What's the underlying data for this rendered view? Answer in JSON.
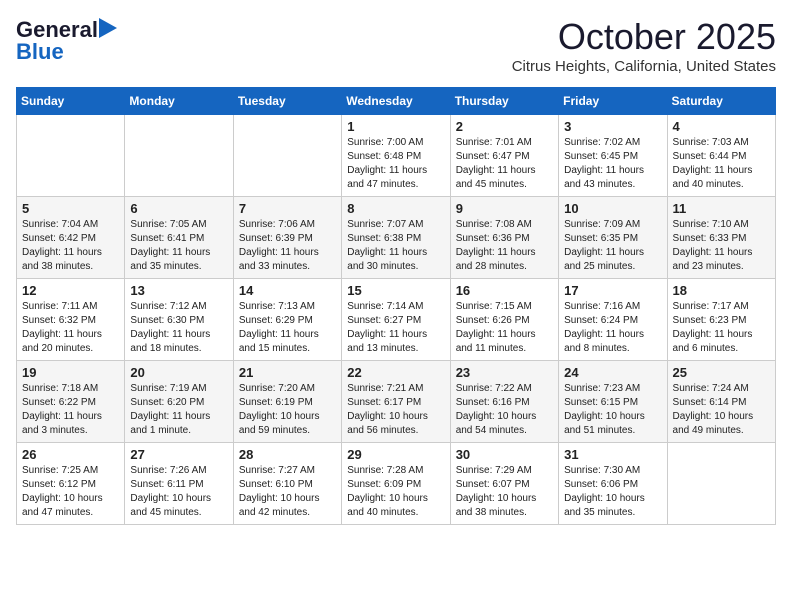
{
  "header": {
    "logo_general": "General",
    "logo_blue": "Blue",
    "month": "October 2025",
    "location": "Citrus Heights, California, United States"
  },
  "weekdays": [
    "Sunday",
    "Monday",
    "Tuesday",
    "Wednesday",
    "Thursday",
    "Friday",
    "Saturday"
  ],
  "weeks": [
    [
      {
        "day": "",
        "text": ""
      },
      {
        "day": "",
        "text": ""
      },
      {
        "day": "",
        "text": ""
      },
      {
        "day": "1",
        "text": "Sunrise: 7:00 AM\nSunset: 6:48 PM\nDaylight: 11 hours\nand 47 minutes."
      },
      {
        "day": "2",
        "text": "Sunrise: 7:01 AM\nSunset: 6:47 PM\nDaylight: 11 hours\nand 45 minutes."
      },
      {
        "day": "3",
        "text": "Sunrise: 7:02 AM\nSunset: 6:45 PM\nDaylight: 11 hours\nand 43 minutes."
      },
      {
        "day": "4",
        "text": "Sunrise: 7:03 AM\nSunset: 6:44 PM\nDaylight: 11 hours\nand 40 minutes."
      }
    ],
    [
      {
        "day": "5",
        "text": "Sunrise: 7:04 AM\nSunset: 6:42 PM\nDaylight: 11 hours\nand 38 minutes."
      },
      {
        "day": "6",
        "text": "Sunrise: 7:05 AM\nSunset: 6:41 PM\nDaylight: 11 hours\nand 35 minutes."
      },
      {
        "day": "7",
        "text": "Sunrise: 7:06 AM\nSunset: 6:39 PM\nDaylight: 11 hours\nand 33 minutes."
      },
      {
        "day": "8",
        "text": "Sunrise: 7:07 AM\nSunset: 6:38 PM\nDaylight: 11 hours\nand 30 minutes."
      },
      {
        "day": "9",
        "text": "Sunrise: 7:08 AM\nSunset: 6:36 PM\nDaylight: 11 hours\nand 28 minutes."
      },
      {
        "day": "10",
        "text": "Sunrise: 7:09 AM\nSunset: 6:35 PM\nDaylight: 11 hours\nand 25 minutes."
      },
      {
        "day": "11",
        "text": "Sunrise: 7:10 AM\nSunset: 6:33 PM\nDaylight: 11 hours\nand 23 minutes."
      }
    ],
    [
      {
        "day": "12",
        "text": "Sunrise: 7:11 AM\nSunset: 6:32 PM\nDaylight: 11 hours\nand 20 minutes."
      },
      {
        "day": "13",
        "text": "Sunrise: 7:12 AM\nSunset: 6:30 PM\nDaylight: 11 hours\nand 18 minutes."
      },
      {
        "day": "14",
        "text": "Sunrise: 7:13 AM\nSunset: 6:29 PM\nDaylight: 11 hours\nand 15 minutes."
      },
      {
        "day": "15",
        "text": "Sunrise: 7:14 AM\nSunset: 6:27 PM\nDaylight: 11 hours\nand 13 minutes."
      },
      {
        "day": "16",
        "text": "Sunrise: 7:15 AM\nSunset: 6:26 PM\nDaylight: 11 hours\nand 11 minutes."
      },
      {
        "day": "17",
        "text": "Sunrise: 7:16 AM\nSunset: 6:24 PM\nDaylight: 11 hours\nand 8 minutes."
      },
      {
        "day": "18",
        "text": "Sunrise: 7:17 AM\nSunset: 6:23 PM\nDaylight: 11 hours\nand 6 minutes."
      }
    ],
    [
      {
        "day": "19",
        "text": "Sunrise: 7:18 AM\nSunset: 6:22 PM\nDaylight: 11 hours\nand 3 minutes."
      },
      {
        "day": "20",
        "text": "Sunrise: 7:19 AM\nSunset: 6:20 PM\nDaylight: 11 hours\nand 1 minute."
      },
      {
        "day": "21",
        "text": "Sunrise: 7:20 AM\nSunset: 6:19 PM\nDaylight: 10 hours\nand 59 minutes."
      },
      {
        "day": "22",
        "text": "Sunrise: 7:21 AM\nSunset: 6:17 PM\nDaylight: 10 hours\nand 56 minutes."
      },
      {
        "day": "23",
        "text": "Sunrise: 7:22 AM\nSunset: 6:16 PM\nDaylight: 10 hours\nand 54 minutes."
      },
      {
        "day": "24",
        "text": "Sunrise: 7:23 AM\nSunset: 6:15 PM\nDaylight: 10 hours\nand 51 minutes."
      },
      {
        "day": "25",
        "text": "Sunrise: 7:24 AM\nSunset: 6:14 PM\nDaylight: 10 hours\nand 49 minutes."
      }
    ],
    [
      {
        "day": "26",
        "text": "Sunrise: 7:25 AM\nSunset: 6:12 PM\nDaylight: 10 hours\nand 47 minutes."
      },
      {
        "day": "27",
        "text": "Sunrise: 7:26 AM\nSunset: 6:11 PM\nDaylight: 10 hours\nand 45 minutes."
      },
      {
        "day": "28",
        "text": "Sunrise: 7:27 AM\nSunset: 6:10 PM\nDaylight: 10 hours\nand 42 minutes."
      },
      {
        "day": "29",
        "text": "Sunrise: 7:28 AM\nSunset: 6:09 PM\nDaylight: 10 hours\nand 40 minutes."
      },
      {
        "day": "30",
        "text": "Sunrise: 7:29 AM\nSunset: 6:07 PM\nDaylight: 10 hours\nand 38 minutes."
      },
      {
        "day": "31",
        "text": "Sunrise: 7:30 AM\nSunset: 6:06 PM\nDaylight: 10 hours\nand 35 minutes."
      },
      {
        "day": "",
        "text": ""
      }
    ]
  ]
}
